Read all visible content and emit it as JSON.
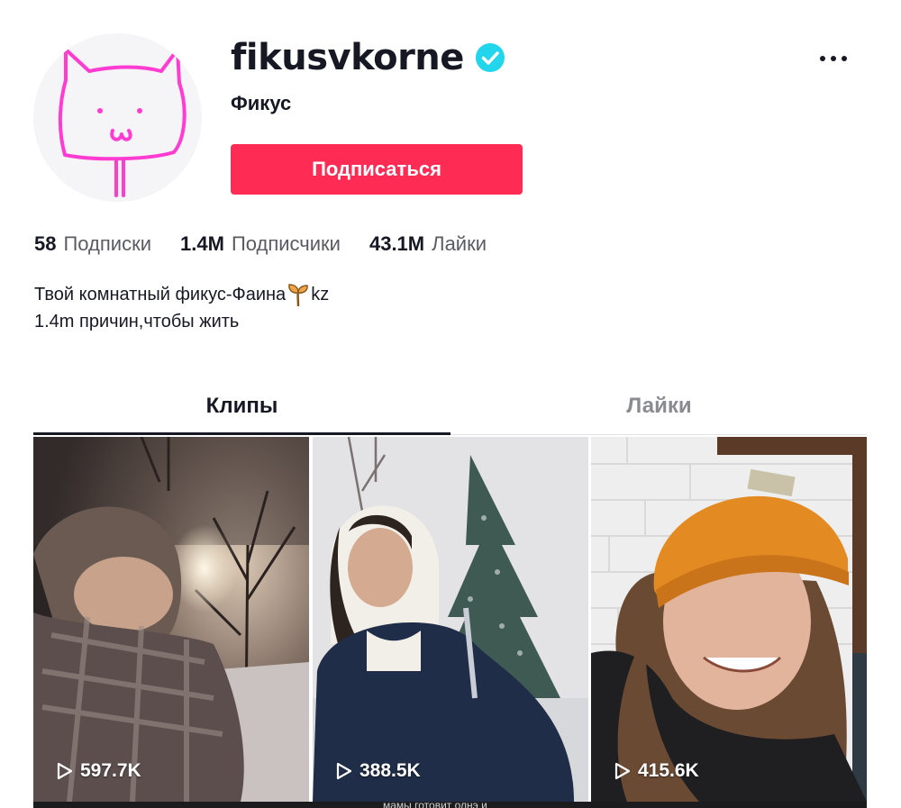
{
  "profile": {
    "username": "fikusvkorne",
    "nickname": "Фикус",
    "follow_label": "Подписаться",
    "verified": true
  },
  "stats": [
    {
      "value": "58",
      "label": "Подписки"
    },
    {
      "value": "1.4M",
      "label": "Подписчики"
    },
    {
      "value": "43.1M",
      "label": "Лайки"
    }
  ],
  "bio": {
    "line1_before": "Твой комнатный фикус-Фаина",
    "line1_after": "kz",
    "line2": "1.4m причин,чтобы жить"
  },
  "tabs": [
    {
      "label": "Клипы",
      "active": true
    },
    {
      "label": "Лайки",
      "active": false
    }
  ],
  "videos": [
    {
      "views": "597.7K"
    },
    {
      "views": "388.5K"
    },
    {
      "views": "415.6K"
    }
  ],
  "caption_peek": "мамы готовит олнэ и",
  "colors": {
    "accent": "#fe2c55",
    "verified": "#20d5ec",
    "text": "#161823",
    "muted": "#5a5b62"
  },
  "icons": [
    "verified-badge-icon",
    "more-options-icon",
    "sprout-emoji-icon",
    "play-icon"
  ]
}
